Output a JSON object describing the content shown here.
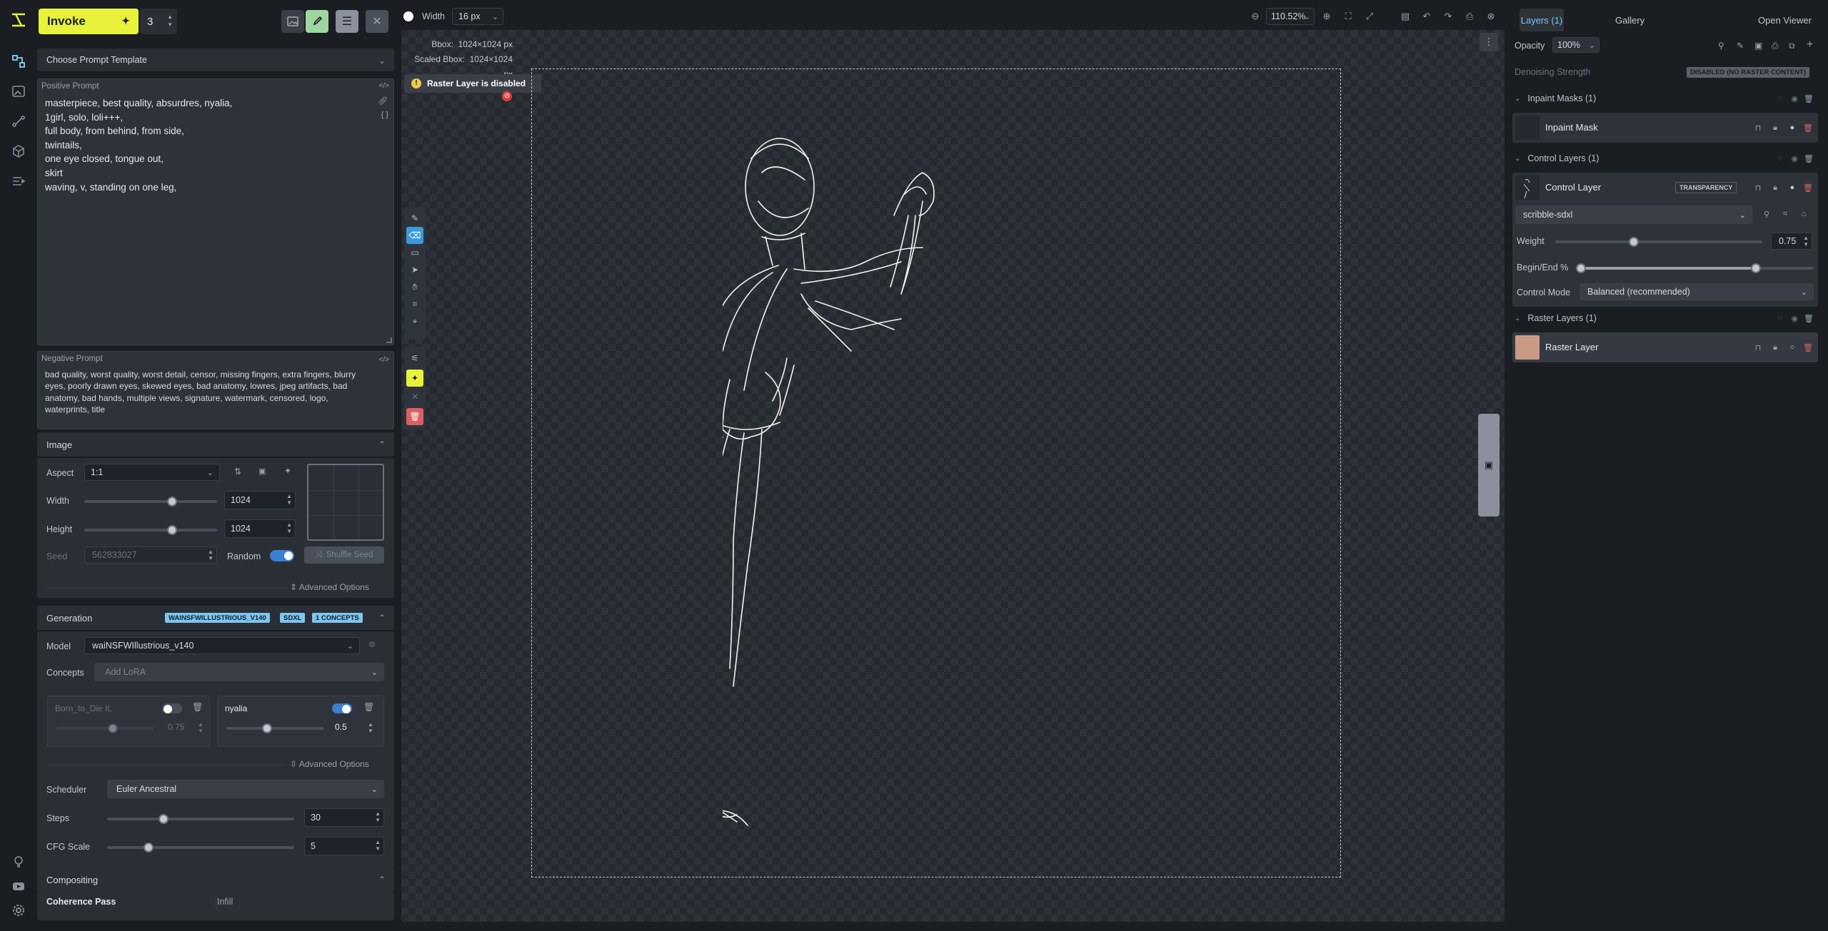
{
  "app": {
    "invoke_label": "Invoke",
    "iterations": "3"
  },
  "prompt": {
    "template_label": "Choose Prompt Template",
    "positive_label": "Positive Prompt",
    "positive_lines": [
      "masterpiece, best quality, absurdres, nyalia,",
      "1girl, solo, loli+++,",
      "full body, from behind, from side,",
      "twintails,",
      "one eye closed, tongue out,",
      "skirt",
      "waving, v, standing on one leg,"
    ],
    "negative_label": "Negative Prompt",
    "negative_text": "bad quality, worst quality, worst detail, censor, missing fingers, extra fingers, blurry eyes, poorly drawn eyes, skewed eyes, bad anatomy, lowres, jpeg artifacts, bad anatomy, bad hands, multiple views, signature, watermark, censored, logo, waterprints, title"
  },
  "image": {
    "title": "Image",
    "aspect_label": "Aspect",
    "aspect_value": "1:1",
    "width_label": "Width",
    "width_value": "1024",
    "width_fraction": 0.66,
    "height_label": "Height",
    "height_value": "1024",
    "height_fraction": 0.66,
    "seed_label": "Seed",
    "seed_value": "562833027",
    "random_label": "Random",
    "random_on": true,
    "shuffle_label": "Shuffle Seed",
    "advanced_label": "Advanced Options"
  },
  "generation": {
    "title": "Generation",
    "badges": [
      "WAINSFWILLUSTRIOUS_V140",
      "SDXL",
      "1 CONCEPTS"
    ],
    "model_label": "Model",
    "model_value": "waiNSFWIllustrious_v140",
    "concepts_label": "Concepts",
    "concepts_placeholder": "Add LoRA",
    "lora": [
      {
        "name": "Born_to_Die IL",
        "enabled": false,
        "weight": "0.75",
        "fraction": 0.6
      },
      {
        "name": "nyalia",
        "enabled": true,
        "weight": "0.5",
        "fraction": 0.5
      }
    ],
    "advanced_label": "Advanced Options",
    "scheduler_label": "Scheduler",
    "scheduler_value": "Euler Ancestral",
    "steps_label": "Steps",
    "steps_value": "30",
    "steps_fraction": 0.3,
    "cfg_label": "CFG Scale",
    "cfg_value": "5",
    "cfg_fraction": 0.22
  },
  "compositing": {
    "title": "Compositing",
    "coherence_label": "Coherence Pass",
    "coherence_value": "Infill"
  },
  "canvas_toolbar": {
    "width_label": "Width",
    "width_value": "16 px",
    "zoom_value": "110.52%"
  },
  "canvas": {
    "bbox_label": "Bbox:",
    "bbox_value": "1024×1024 px",
    "scaled_bbox_label": "Scaled Bbox:",
    "scaled_bbox_value": "1024×1024 px",
    "warning": "Raster Layer is disabled"
  },
  "right": {
    "tab_layers": "Layers (1)",
    "tab_gallery": "Gallery",
    "open_viewer": "Open Viewer",
    "opacity_label": "Opacity",
    "opacity_value": "100%",
    "denoise_label": "Denoising Strength",
    "denoise_badge": "DISABLED (NO RASTER CONTENT)",
    "inpaint_group": "Inpaint Masks (1)",
    "inpaint_layer": "Inpaint Mask",
    "control_group": "Control Layers (1)",
    "control_layer": "Control Layer",
    "transparency_badge": "TRANSPARENCY",
    "control_model": "scribble-sdxl",
    "weight_label": "Weight",
    "weight_value": "0.75",
    "weight_fraction": 0.38,
    "begin_end_label": "Begin/End %",
    "begin_fraction": 0.0,
    "end_fraction": 0.75,
    "control_mode_label": "Control Mode",
    "control_mode_value": "Balanced (recommended)",
    "raster_group": "Raster Layers (1)",
    "raster_layer": "Raster Layer"
  },
  "colors": {
    "accent_yellow": "#e8f23a",
    "accent_blue": "#7cc6f0",
    "danger": "#d9605f"
  }
}
